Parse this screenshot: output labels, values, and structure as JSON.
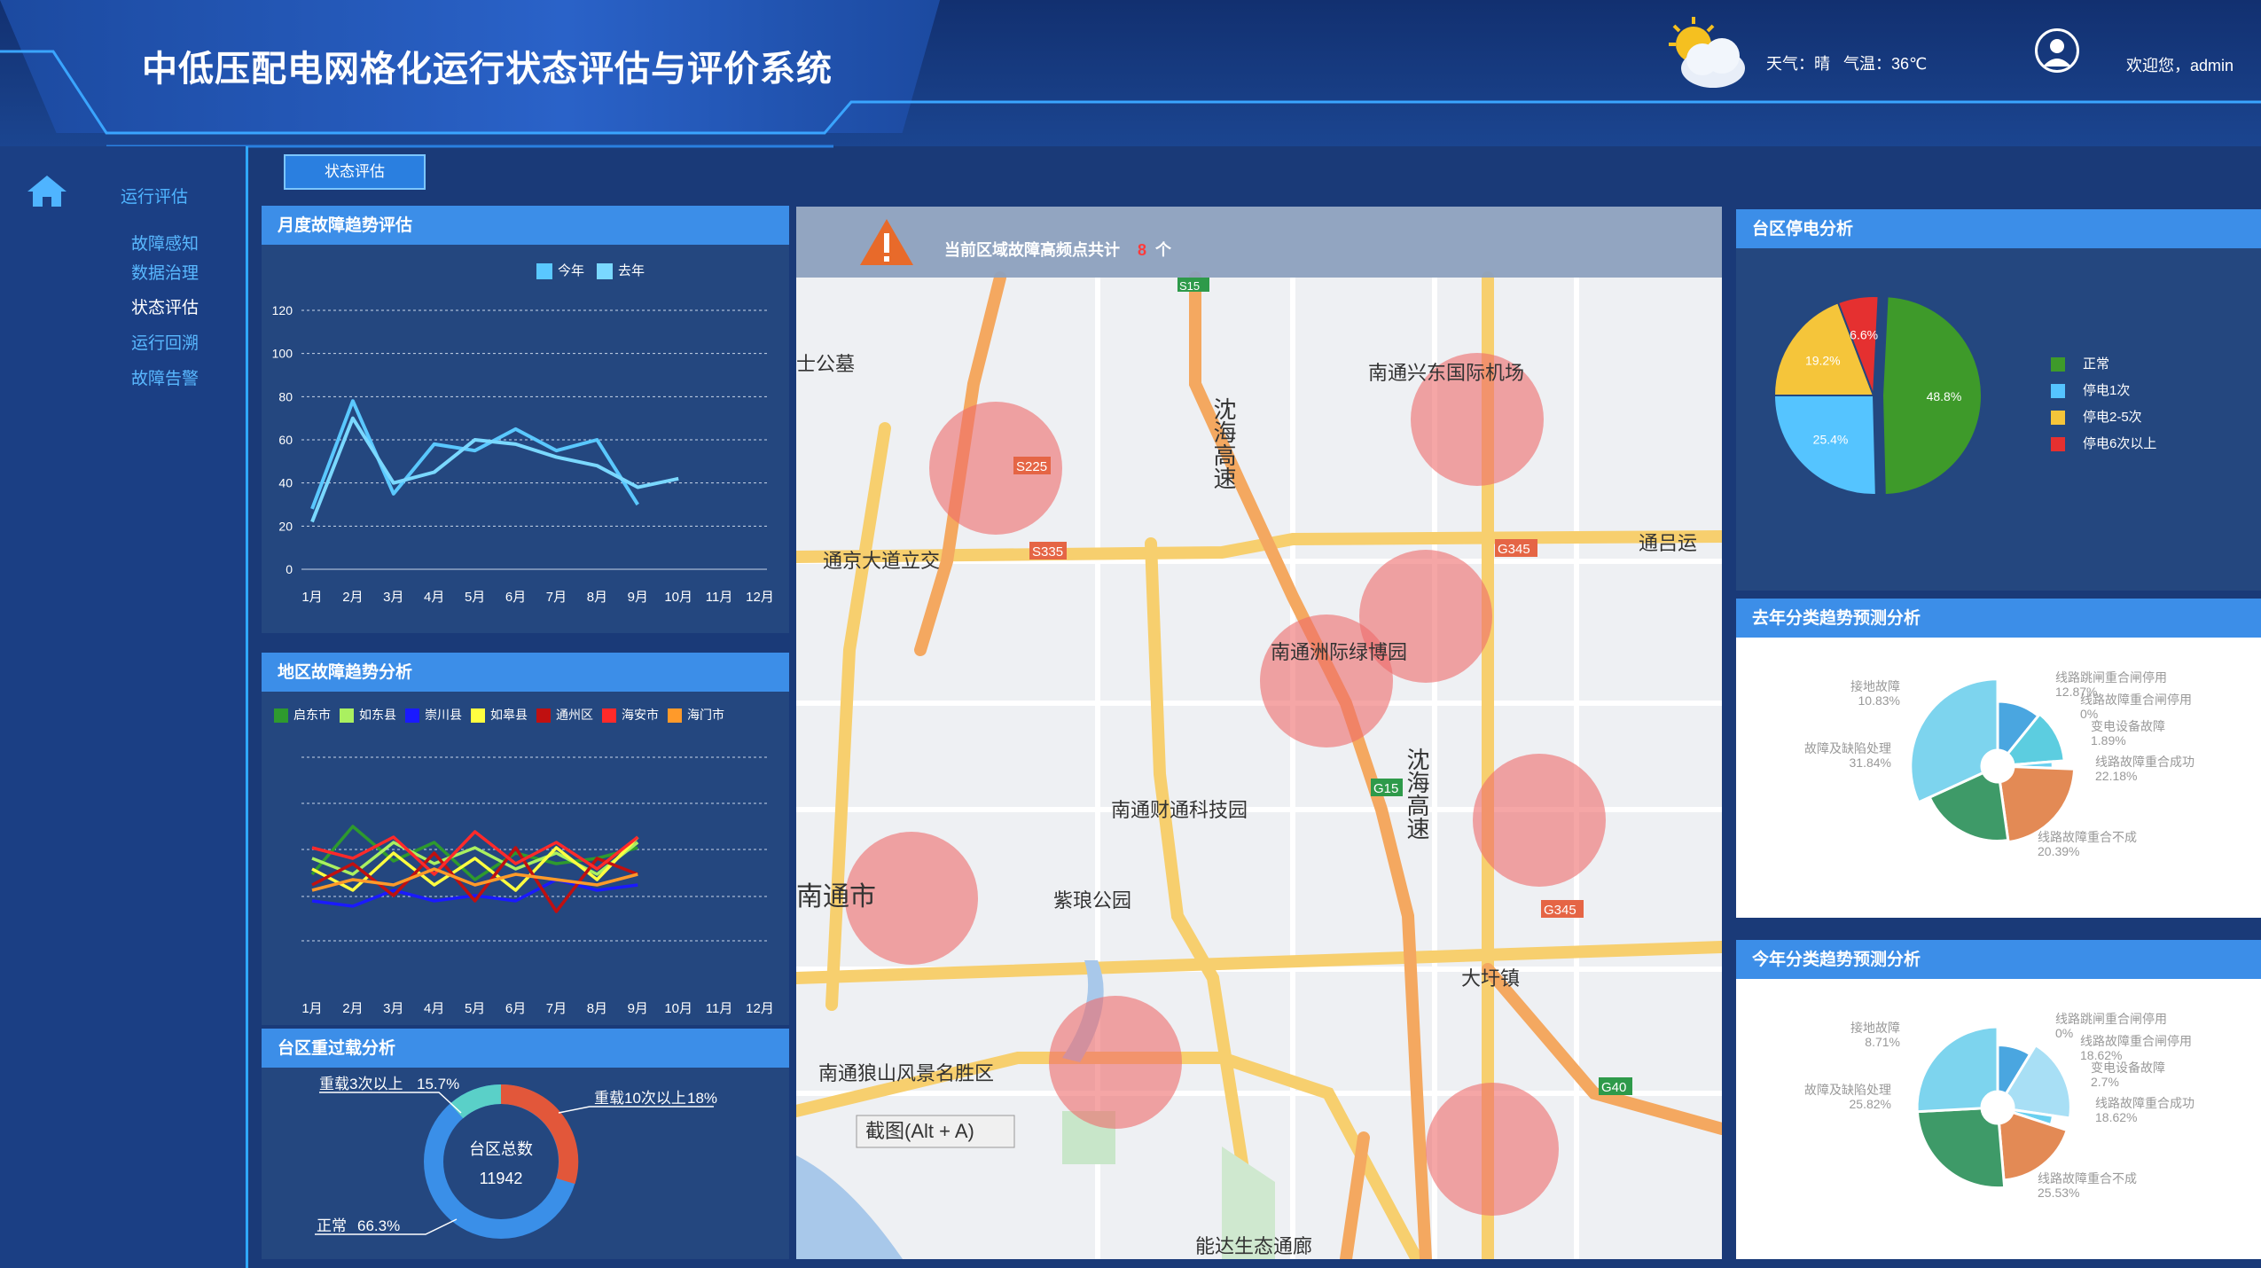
{
  "header": {
    "title": "中低压配电网格化运行状态评估与评价系统",
    "weather": "天气：晴",
    "temperature": "气温：36℃",
    "welcome": "欢迎您，admin"
  },
  "sidebar": {
    "root": "运行评估",
    "items": [
      {
        "label": "故障感知"
      },
      {
        "label": "数据治理"
      },
      {
        "label": "状态评估"
      },
      {
        "label": "运行回溯"
      },
      {
        "label": "故障告警"
      }
    ]
  },
  "tab": {
    "label": "状态评估"
  },
  "monthly": {
    "title": "月度故障趋势评估",
    "legend": [
      "今年",
      "去年"
    ]
  },
  "region": {
    "title": "地区故障趋势分析",
    "legend": [
      "启东市",
      "如东县",
      "崇川县",
      "如皋县",
      "通州区",
      "海安市",
      "海门市"
    ]
  },
  "overload": {
    "title": "台区重过载分析",
    "center_label": "台区总数",
    "center_value": "11942",
    "labels": [
      {
        "text": "重载3次以上",
        "pct": "15.7%"
      },
      {
        "text": "重载10次以上",
        "pct": "18%"
      },
      {
        "text": "正常",
        "pct": "66.3%"
      }
    ]
  },
  "map": {
    "banner_prefix": "当前区域故障高频点共计",
    "banner_count": "8",
    "banner_suffix": "个",
    "labels": [
      "南通兴东国际机场",
      "通京大道立交",
      "南通洲际绿博园",
      "南通财通科技园",
      "南通市",
      "紫琅公园",
      "大圩镇",
      "南通狼山风景名胜区",
      "能达生态通廊",
      "通吕运",
      "沈海高速",
      "士公墓"
    ],
    "road_shields": [
      "S225",
      "S335",
      "G345",
      "G15",
      "G345",
      "G40",
      "S15"
    ],
    "screenshot_hint": "截图(Alt + A)"
  },
  "outage": {
    "title": "台区停电分析",
    "legend": [
      "正常",
      "停电1次",
      "停电2-5次",
      "停电6次以上"
    ],
    "pcts": [
      "48.8%",
      "25.4%",
      "19.2%",
      "6.6%"
    ],
    "colors": [
      "#3e9a2a",
      "#55c4ff",
      "#f5c53a",
      "#e53030"
    ]
  },
  "last_year": {
    "title": "去年分类趋势预测分析",
    "labels": [
      {
        "name": "接地故障",
        "pct": "10.83%"
      },
      {
        "name": "线路跳闸重合闸停用",
        "pct": "12.87%"
      },
      {
        "name": "线路故障重合闸停用",
        "pct": "0%"
      },
      {
        "name": "变电设备故障",
        "pct": "1.89%"
      },
      {
        "name": "线路故障重合成功",
        "pct": "22.18%"
      },
      {
        "name": "线路故障重合不成",
        "pct": "20.39%"
      },
      {
        "name": "故障及缺陷处理",
        "pct": "31.84%"
      }
    ]
  },
  "this_year": {
    "title": "今年分类趋势预测分析",
    "labels": [
      {
        "name": "接地故障",
        "pct": "8.71%"
      },
      {
        "name": "线路跳闸重合闸停用",
        "pct": "0%"
      },
      {
        "name": "线路故障重合闸停用",
        "pct": "18.62%"
      },
      {
        "name": "变电设备故障",
        "pct": "2.7%"
      },
      {
        "name": "线路故障重合成功",
        "pct": "18.62%"
      },
      {
        "name": "线路故障重合不成",
        "pct": "25.53%"
      },
      {
        "name": "故障及缺陷处理",
        "pct": "25.82%"
      }
    ]
  },
  "chart_data": [
    {
      "type": "line",
      "title": "月度故障趋势评估",
      "categories": [
        "1月",
        "2月",
        "3月",
        "4月",
        "5月",
        "6月",
        "7月",
        "8月",
        "9月",
        "10月",
        "11月",
        "12月"
      ],
      "ylim": [
        0,
        120
      ],
      "yticks": [
        0,
        20,
        40,
        60,
        80,
        100,
        120
      ],
      "series": [
        {
          "name": "今年",
          "values": [
            28,
            78,
            35,
            58,
            55,
            65,
            55,
            60,
            30,
            null,
            null,
            null
          ]
        },
        {
          "name": "去年",
          "values": [
            22,
            70,
            40,
            45,
            60,
            58,
            52,
            48,
            38,
            42,
            null,
            null
          ]
        }
      ],
      "colors": [
        "#5ac8ff",
        "#7ad8ff"
      ]
    },
    {
      "type": "line",
      "title": "地区故障趋势分析",
      "categories": [
        "1月",
        "2月",
        "3月",
        "4月",
        "5月",
        "6月",
        "7月",
        "8月",
        "9月",
        "10月",
        "11月",
        "12月"
      ],
      "series": [
        {
          "name": "启东市",
          "values": [
            40,
            58,
            45,
            52,
            38,
            48,
            44,
            46,
            50
          ]
        },
        {
          "name": "如东县",
          "values": [
            46,
            40,
            52,
            44,
            50,
            42,
            48,
            40,
            52
          ]
        },
        {
          "name": "崇川县",
          "values": [
            30,
            28,
            34,
            30,
            32,
            30,
            38,
            34,
            36
          ]
        },
        {
          "name": "如皋县",
          "values": [
            42,
            34,
            48,
            36,
            46,
            34,
            50,
            38,
            54
          ]
        },
        {
          "name": "通州区",
          "values": [
            36,
            44,
            32,
            48,
            30,
            50,
            26,
            46,
            40
          ]
        },
        {
          "name": "海安市",
          "values": [
            50,
            46,
            54,
            40,
            56,
            44,
            52,
            42,
            54
          ]
        },
        {
          "name": "海门市",
          "values": [
            34,
            38,
            36,
            42,
            36,
            40,
            38,
            36,
            40
          ]
        }
      ],
      "colors": [
        "#2e9a2e",
        "#aaf060",
        "#1a1aff",
        "#ffff40",
        "#c01010",
        "#ff2a2a",
        "#ff9a2a"
      ]
    }
  ]
}
